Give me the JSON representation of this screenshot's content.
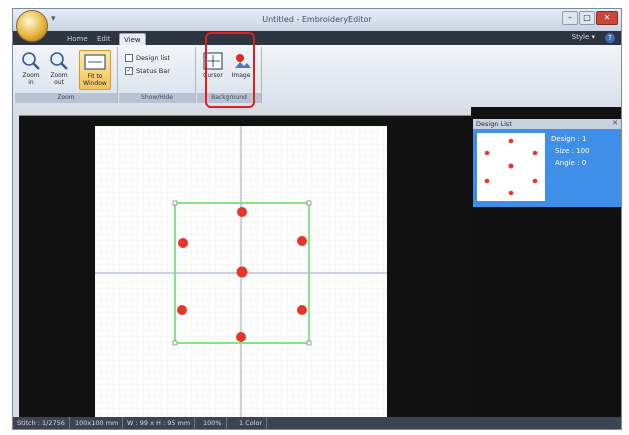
{
  "window": {
    "title": "Untitled - EmbroideryEditor"
  },
  "tabs": [
    {
      "label": "Home"
    },
    {
      "label": "Edit"
    },
    {
      "label": "View"
    }
  ],
  "style_menu": "Style ▾",
  "ribbon": {
    "zoom_in": "Zoom in",
    "zoom_out": "Zoom out",
    "fit_to_window": "Fit to Window",
    "zoom_group": "Zoom",
    "design_list": "Design list",
    "status_bar": "Status Bar",
    "show_hide_group": "Show/Hide",
    "cursor": "Cursor",
    "image": "Image",
    "background_group": "Background"
  },
  "design_list_panel": {
    "title": "Design List",
    "design_label": "Design : 1",
    "size_label": "Size : 100",
    "angle_label": "Angle : 0"
  },
  "status": {
    "stitches": "Stitch : 1/2756",
    "size": "100x100 mm",
    "position": "W : 99 x H : 95 mm",
    "zoom": "100%",
    "color": "1 Color"
  },
  "colors": {
    "accent_red": "#e02020",
    "stitch_red": "#e8352a",
    "guide_green": "#7ee07e",
    "panel_blue": "#3f8fe8"
  }
}
